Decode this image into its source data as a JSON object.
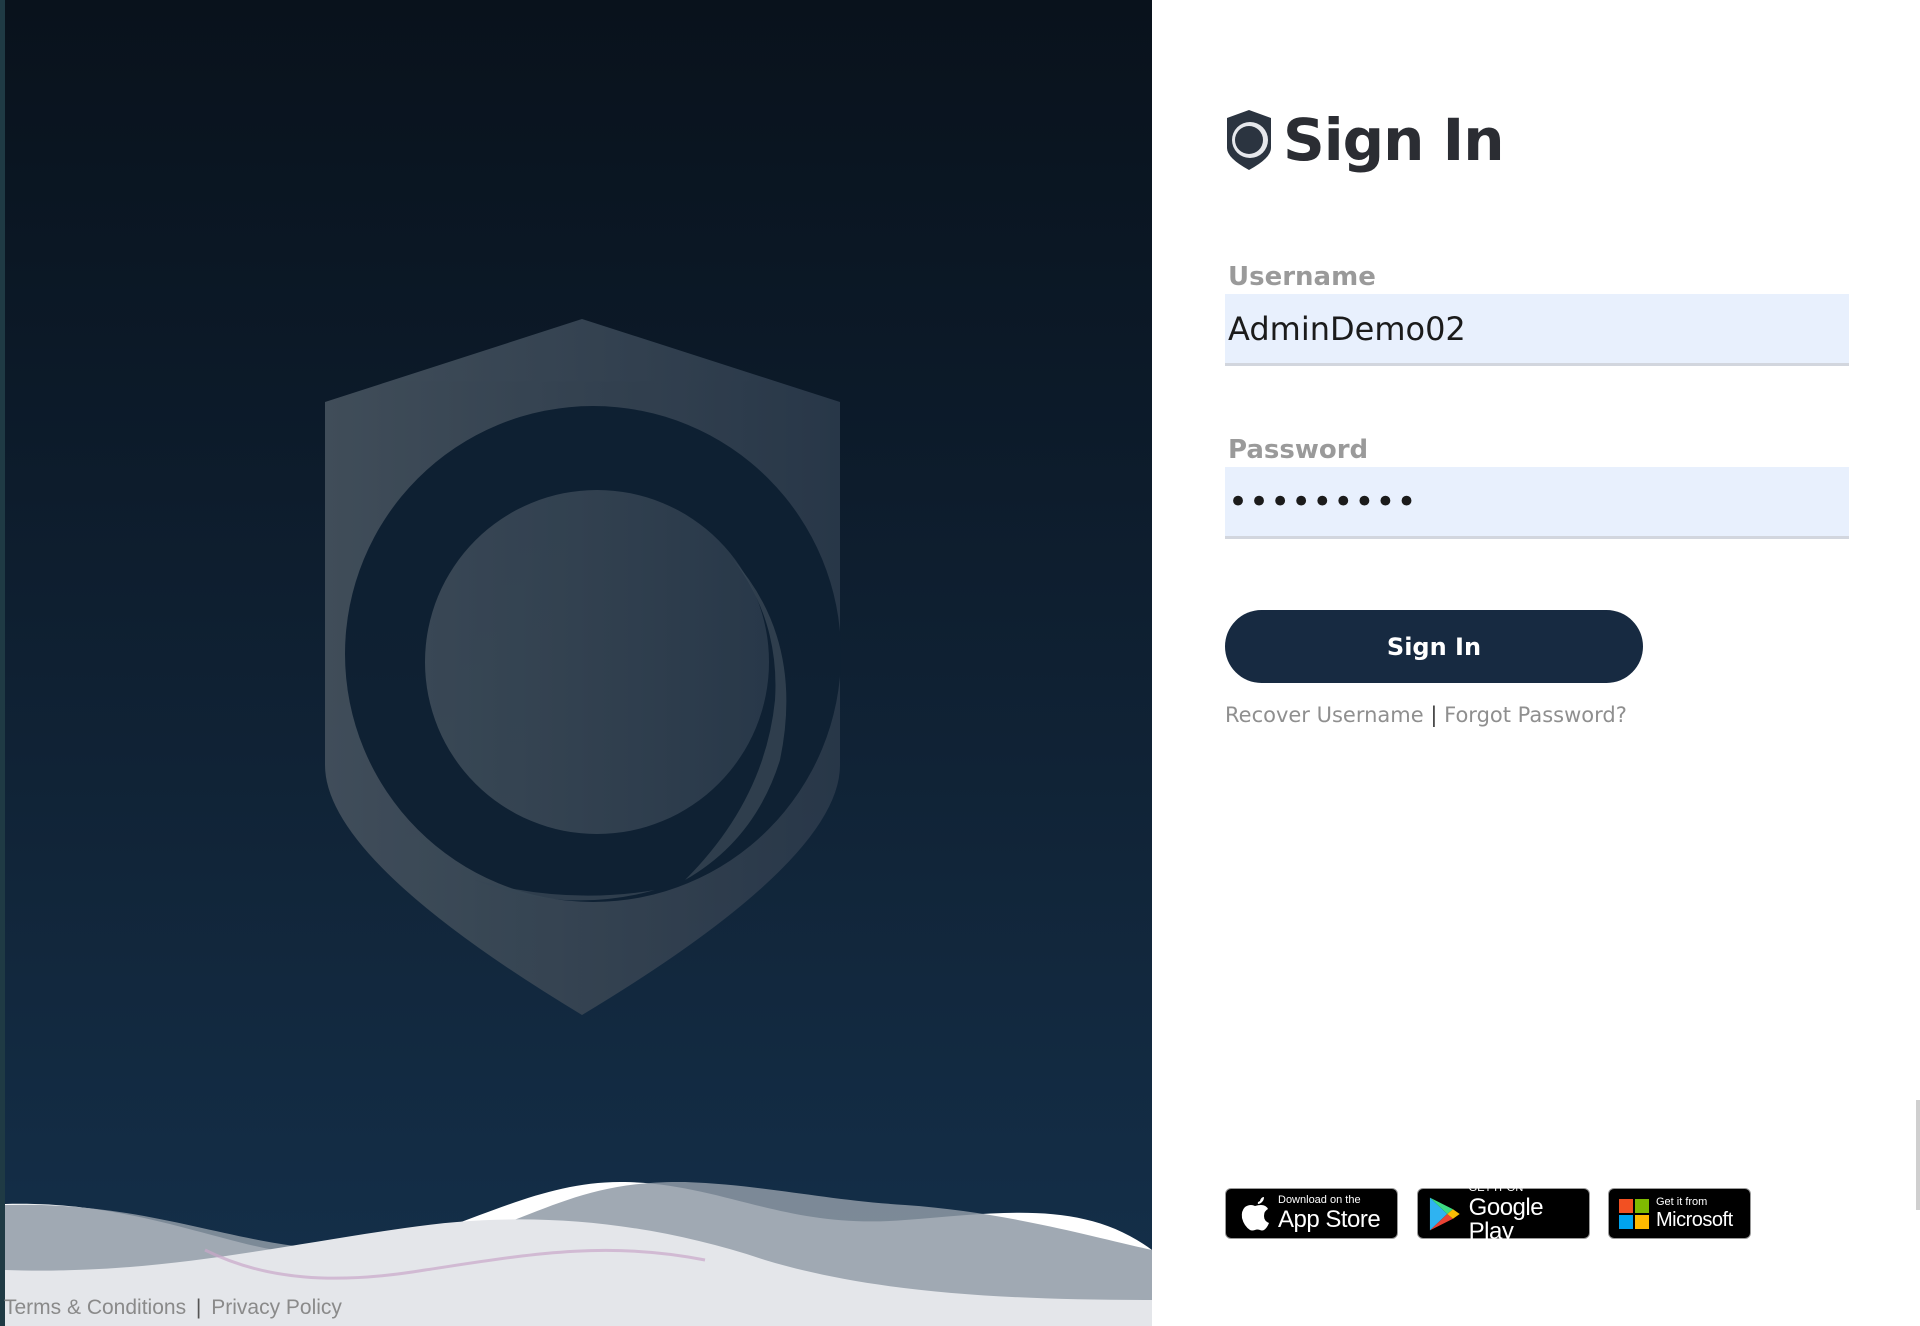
{
  "hero": {
    "footer": {
      "terms_label": "Terms & Conditions",
      "separator": "|",
      "privacy_label": "Privacy Policy"
    }
  },
  "signin": {
    "title": "Sign In",
    "username": {
      "label": "Username",
      "value": "AdminDemo02"
    },
    "password": {
      "label": "Password",
      "value": "•••••••••"
    },
    "submit_label": "Sign In",
    "recover_username_label": "Recover Username",
    "separator": "|",
    "forgot_password_label": "Forgot Password?"
  },
  "badges": {
    "app_store": {
      "small": "Download on the",
      "big": "App Store",
      "icon": "apple-icon"
    },
    "google_play": {
      "small": "GET IT ON",
      "big": "Google Play",
      "icon": "play-icon"
    },
    "microsoft": {
      "small": "Get it from",
      "big": "Microsoft",
      "icon": "windows-icon"
    }
  },
  "colors": {
    "hero_top": "#09121c",
    "hero_bottom": "#14304b",
    "button": "#172a41",
    "field_bg": "#e8f0fd"
  }
}
